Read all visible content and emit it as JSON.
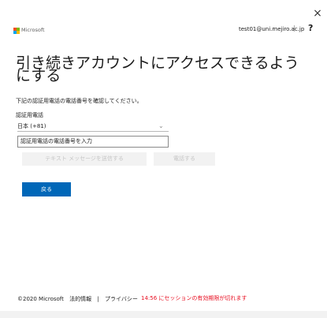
{
  "window": {
    "close_glyph": "×"
  },
  "header": {
    "brand": "Microsoft",
    "logo_colors": [
      "#f25022",
      "#7fba00",
      "#00a4ef",
      "#ffb900"
    ],
    "account": "test01@uni.mejiro.ac.jp",
    "separator": "|",
    "help_glyph": "?"
  },
  "main": {
    "title": "引き続きアカウントにアクセスできるようにする",
    "description": "下記の認証用電話の電話番号を確認してください。",
    "field_label": "認証用電話",
    "country_select": {
      "value": "日本 (+81)"
    },
    "phone_input": {
      "placeholder": "認証用電話の電話番号を入力",
      "value": ""
    },
    "buttons": {
      "send_sms": "テキスト メッセージを送信する",
      "call": "電話する",
      "back": "戻る"
    }
  },
  "footer": {
    "copyright": "©2020 Microsoft",
    "terms": "法的情報",
    "separator": "|",
    "privacy": "プライバシー",
    "session_notice": "14:56 にセッションの有効期限が切れます"
  },
  "colors": {
    "accent": "#0067b8",
    "warning": "#e81123"
  }
}
